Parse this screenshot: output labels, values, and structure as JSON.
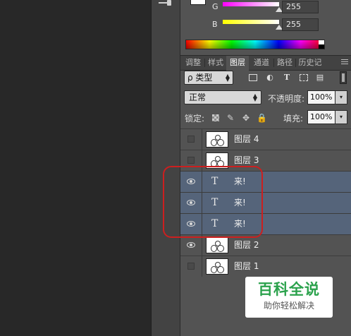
{
  "color_panel": {
    "channels": [
      {
        "label": "G",
        "value": "255",
        "gradient_from": "#ff00ff",
        "gradient_to": "#ffffff"
      },
      {
        "label": "B",
        "value": "255",
        "gradient_from": "#ffff00",
        "gradient_to": "#ffffff"
      }
    ]
  },
  "tabs": [
    {
      "label": "调整"
    },
    {
      "label": "样式"
    },
    {
      "label": "图层",
      "active": true
    },
    {
      "label": "通道"
    },
    {
      "label": "路径"
    },
    {
      "label": "历史记"
    }
  ],
  "filter": {
    "kind": "ρ 类型"
  },
  "blend": {
    "mode": "正常",
    "opacity_label": "不透明度:",
    "opacity": "100%"
  },
  "lock": {
    "label": "锁定:",
    "fill_label": "填充:",
    "fill": "100%"
  },
  "layers": [
    {
      "name": "图层 4",
      "type": "image",
      "visible": false,
      "selected": false
    },
    {
      "name": "图层 3",
      "type": "image",
      "visible": false,
      "selected": false
    },
    {
      "name": "来!",
      "type": "text",
      "glyph": "T",
      "visible": true,
      "selected": true
    },
    {
      "name": "来!",
      "type": "text",
      "glyph": "T",
      "visible": true,
      "selected": true
    },
    {
      "name": "来!",
      "type": "text",
      "glyph": "T",
      "visible": true,
      "selected": true
    },
    {
      "name": "图层 2",
      "type": "image",
      "visible": true,
      "selected": false
    },
    {
      "name": "图层 1",
      "type": "image",
      "visible": false,
      "selected": false
    }
  ],
  "watermark": {
    "title": "百科全说",
    "subtitle": "助你轻松解决"
  },
  "colors": {
    "selected_row": "#55647a",
    "annotation": "#cc1f1f",
    "watermark_green": "#2ba24c"
  }
}
